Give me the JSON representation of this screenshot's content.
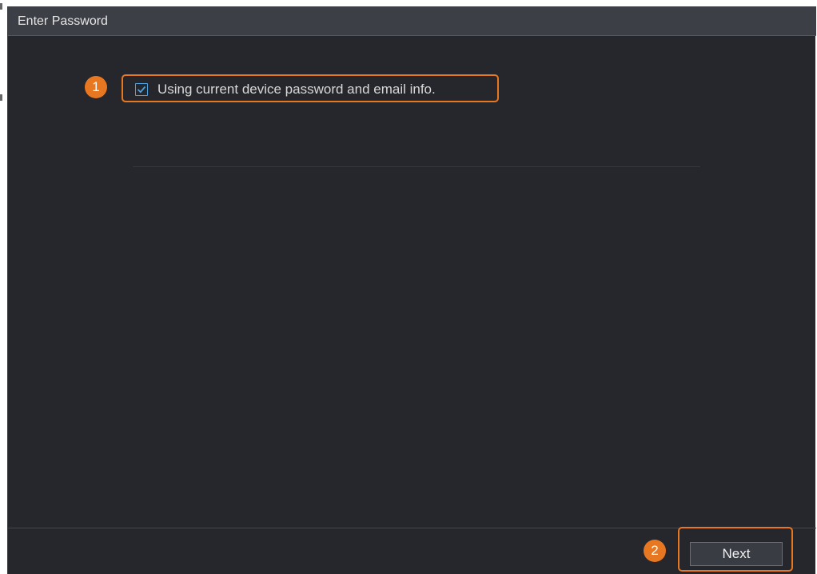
{
  "dialog": {
    "title": "Enter Password"
  },
  "option": {
    "label": "Using current device password and email info.",
    "checked": true,
    "callout_number": "1"
  },
  "footer": {
    "next_label": "Next",
    "callout_number": "2"
  },
  "colors": {
    "callout": "#e87722",
    "checkbox": "#4aa3e0",
    "background": "#26272c",
    "title_bar": "#3d3f46"
  },
  "icons": {
    "checkbox": "checkmark-icon"
  }
}
